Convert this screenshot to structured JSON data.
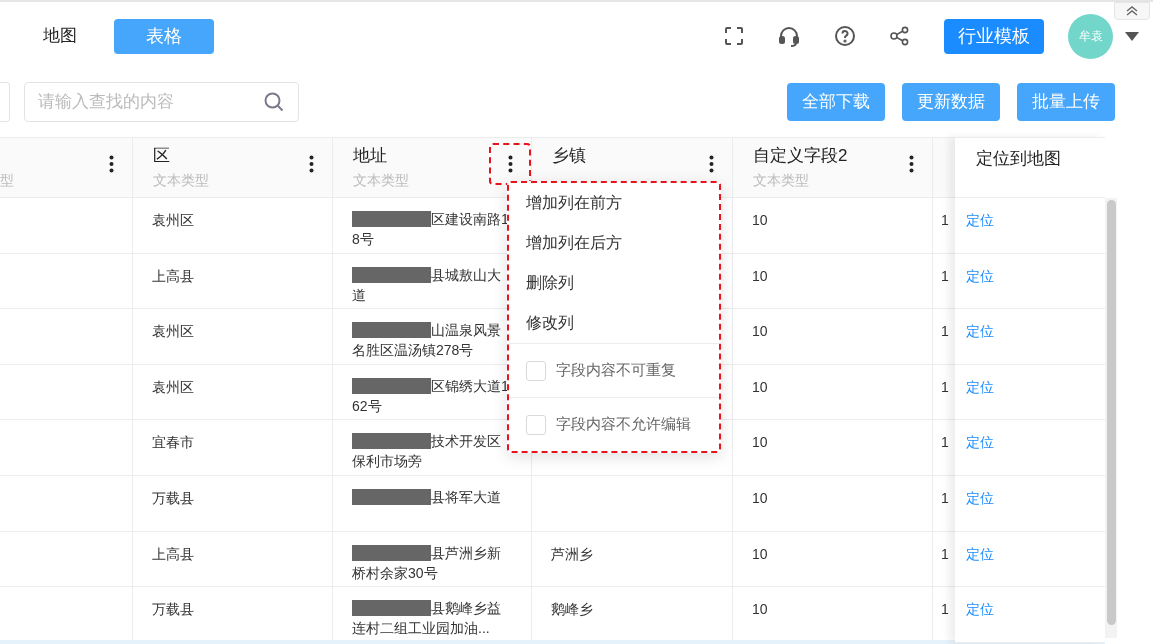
{
  "view_tabs": [
    {
      "label": "地图",
      "selected": false
    },
    {
      "label": "表格",
      "selected": true
    }
  ],
  "template_button": "行业模板",
  "avatar": "牟袁",
  "search": {
    "placeholder": "请输入查找的内容"
  },
  "actions": [
    "全部下载",
    "更新数据",
    "批量上传"
  ],
  "table": {
    "columns": [
      {
        "subtitle": "型",
        "menu_open": false
      },
      {
        "title": "区",
        "subtitle": "文本类型",
        "menu_open": false
      },
      {
        "title": "地址",
        "subtitle": "文本类型",
        "menu_open": true
      },
      {
        "title": "乡镇",
        "menu_open": false
      },
      {
        "title": "自定义字段2",
        "subtitle": "文本类型",
        "menu_open": false
      }
    ],
    "fixed_column": "定位到地图",
    "rows": [
      {
        "district": "袁州区",
        "address": [
          "区建设南路1",
          "8号"
        ],
        "custom_field_2": "10",
        "column_6": "1",
        "locate": "定位"
      },
      {
        "district": "上高县",
        "address": [
          "县城敖山大",
          "道"
        ],
        "custom_field_2": "10",
        "column_6": "1",
        "locate": "定位"
      },
      {
        "district": "袁州区",
        "address": [
          "山温泉风景",
          "名胜区温汤镇278号"
        ],
        "custom_field_2": "10",
        "column_6": "1",
        "locate": "定位"
      },
      {
        "district": "袁州区",
        "address": [
          "区锦绣大道1",
          "62号"
        ],
        "custom_field_2": "10",
        "column_6": "1",
        "locate": "定位"
      },
      {
        "district": "宜春市",
        "address": [
          "技术开发区",
          "保利市场旁"
        ],
        "custom_field_2": "10",
        "column_6": "1",
        "locate": "定位"
      },
      {
        "district": "万载县",
        "address": [
          "县将军大道"
        ],
        "custom_field_2": "10",
        "column_6": "1",
        "locate": "定位"
      },
      {
        "district": "上高县",
        "address": [
          "县芦洲乡新",
          "桥村余家30号"
        ],
        "township": "芦洲乡",
        "custom_field_2": "10",
        "column_6": "1",
        "locate": "定位"
      },
      {
        "district": "万载县",
        "address": [
          "县鹅峰乡益",
          "连村二组工业园加油..."
        ],
        "township": "鹅峰乡",
        "custom_field_2": "10",
        "column_6": "1",
        "locate": "定位"
      }
    ]
  },
  "column_menu": {
    "items": [
      "增加列在前方",
      "增加列在后方",
      "删除列",
      "修改列"
    ],
    "options": [
      {
        "label": "字段内容不可重复",
        "checked": false
      },
      {
        "label": "字段内容不允许编辑",
        "checked": false
      }
    ]
  }
}
